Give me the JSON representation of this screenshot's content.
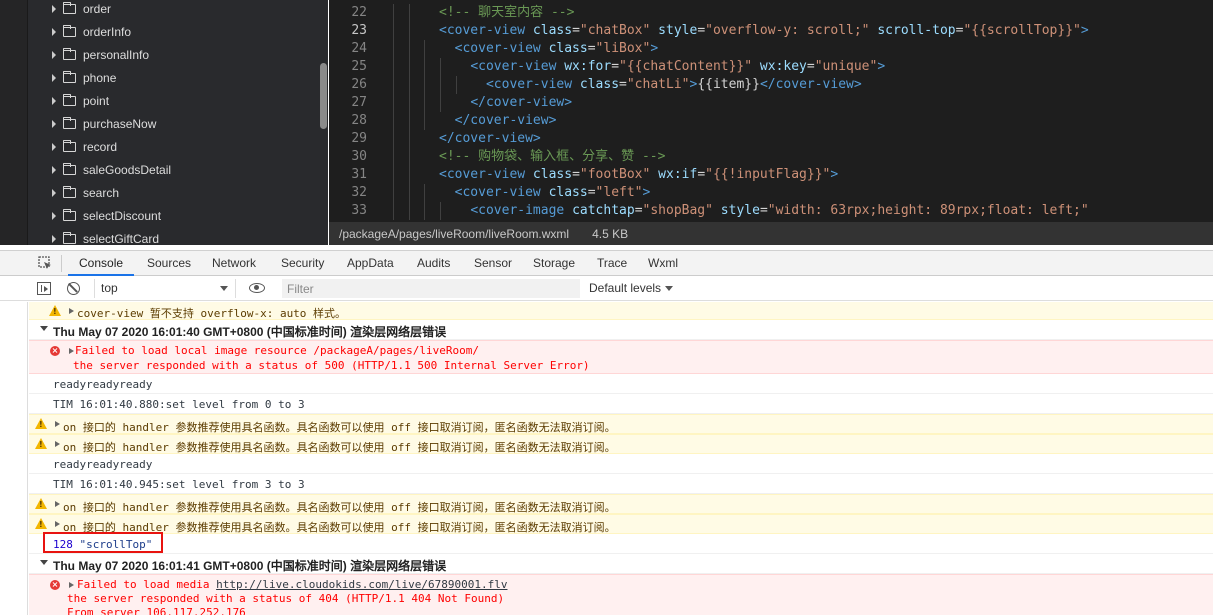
{
  "file_tree": {
    "items": [
      "order",
      "orderInfo",
      "personalInfo",
      "phone",
      "point",
      "purchaseNow",
      "record",
      "saleGoodsDetail",
      "search",
      "selectDiscount",
      "selectGiftCard"
    ]
  },
  "editor": {
    "lines": [
      {
        "num": "22",
        "indent": 4,
        "parts": [
          {
            "c": "cm",
            "t": "<!-- 聊天室内容 -->"
          }
        ]
      },
      {
        "num": "23",
        "indent": 4,
        "current": true,
        "parts": [
          {
            "c": "tg",
            "t": "<cover-view "
          },
          {
            "c": "at",
            "t": "class"
          },
          {
            "c": "tx",
            "t": "="
          },
          {
            "c": "st",
            "t": "\"chatBox\""
          },
          {
            "c": "tx",
            "t": " "
          },
          {
            "c": "at",
            "t": "style"
          },
          {
            "c": "tx",
            "t": "="
          },
          {
            "c": "st",
            "t": "\"overflow-y: scroll;\""
          },
          {
            "c": "tx",
            "t": " "
          },
          {
            "c": "at",
            "t": "scroll-top"
          },
          {
            "c": "tx",
            "t": "="
          },
          {
            "c": "st",
            "t": "\"{{scrollTop}}\""
          },
          {
            "c": "tg",
            "t": ">"
          }
        ]
      },
      {
        "num": "24",
        "indent": 6,
        "parts": [
          {
            "c": "tg",
            "t": "<cover-view "
          },
          {
            "c": "at",
            "t": "class"
          },
          {
            "c": "tx",
            "t": "="
          },
          {
            "c": "st",
            "t": "\"liBox\""
          },
          {
            "c": "tg",
            "t": ">"
          }
        ]
      },
      {
        "num": "25",
        "indent": 8,
        "parts": [
          {
            "c": "tg",
            "t": "<cover-view "
          },
          {
            "c": "at",
            "t": "wx:for"
          },
          {
            "c": "tx",
            "t": "="
          },
          {
            "c": "st",
            "t": "\"{{chatContent}}\""
          },
          {
            "c": "tx",
            "t": " "
          },
          {
            "c": "at",
            "t": "wx:key"
          },
          {
            "c": "tx",
            "t": "="
          },
          {
            "c": "st",
            "t": "\"unique\""
          },
          {
            "c": "tg",
            "t": ">"
          }
        ]
      },
      {
        "num": "26",
        "indent": 10,
        "parts": [
          {
            "c": "tg",
            "t": "<cover-view "
          },
          {
            "c": "at",
            "t": "class"
          },
          {
            "c": "tx",
            "t": "="
          },
          {
            "c": "st",
            "t": "\"chatLi\""
          },
          {
            "c": "tg",
            "t": ">"
          },
          {
            "c": "tx",
            "t": "{{item}}"
          },
          {
            "c": "tg",
            "t": "</cover-view>"
          }
        ]
      },
      {
        "num": "27",
        "indent": 8,
        "parts": [
          {
            "c": "tg",
            "t": "</cover-view>"
          }
        ]
      },
      {
        "num": "28",
        "indent": 6,
        "parts": [
          {
            "c": "tg",
            "t": "</cover-view>"
          }
        ]
      },
      {
        "num": "29",
        "indent": 4,
        "parts": [
          {
            "c": "tg",
            "t": "</cover-view>"
          }
        ]
      },
      {
        "num": "30",
        "indent": 4,
        "parts": [
          {
            "c": "cm",
            "t": "<!-- 购物袋、输入框、分享、赞 -->"
          }
        ]
      },
      {
        "num": "31",
        "indent": 4,
        "parts": [
          {
            "c": "tg",
            "t": "<cover-view "
          },
          {
            "c": "at",
            "t": "class"
          },
          {
            "c": "tx",
            "t": "="
          },
          {
            "c": "st",
            "t": "\"footBox\""
          },
          {
            "c": "tx",
            "t": " "
          },
          {
            "c": "at",
            "t": "wx:if"
          },
          {
            "c": "tx",
            "t": "="
          },
          {
            "c": "st",
            "t": "\"{{!inputFlag}}\""
          },
          {
            "c": "tg",
            "t": ">"
          }
        ]
      },
      {
        "num": "32",
        "indent": 6,
        "parts": [
          {
            "c": "tg",
            "t": "<cover-view "
          },
          {
            "c": "at",
            "t": "class"
          },
          {
            "c": "tx",
            "t": "="
          },
          {
            "c": "st",
            "t": "\"left\""
          },
          {
            "c": "tg",
            "t": ">"
          }
        ]
      },
      {
        "num": "33",
        "indent": 8,
        "parts": [
          {
            "c": "tg",
            "t": "<cover-image "
          },
          {
            "c": "at",
            "t": "catchtap"
          },
          {
            "c": "tx",
            "t": "="
          },
          {
            "c": "st",
            "t": "\"shopBag\""
          },
          {
            "c": "tx",
            "t": " "
          },
          {
            "c": "at",
            "t": "style"
          },
          {
            "c": "tx",
            "t": "="
          },
          {
            "c": "st",
            "t": "\"width: 63rpx;height: 89rpx;float: left;\""
          }
        ]
      }
    ],
    "status_path": "/packageA/pages/liveRoom/liveRoom.wxml",
    "status_size": "4.5 KB"
  },
  "devtools": {
    "tabs": [
      "Console",
      "Sources",
      "Network",
      "Security",
      "AppData",
      "Audits",
      "Sensor",
      "Storage",
      "Trace",
      "Wxml"
    ],
    "active_tab": "Console"
  },
  "console_toolbar": {
    "context": "top",
    "filter_placeholder": "Filter",
    "levels": "Default levels"
  },
  "console": {
    "warn_1": "cover-view 暂不支持 overflow-x: auto 样式。",
    "group_1": "Thu May 07 2020 16:01:40 GMT+0800 (中国标准时间) 渲染层网络层错误",
    "err_1_line1": "Failed to load local image resource /packageA/pages/liveRoom/",
    "err_1_line2": "the server responded with a status of 500 (HTTP/1.1 500 Internal Server Error)",
    "log_1": "readyreadyready",
    "log_2": "TIM 16:01:40.880:set level from 0 to 3",
    "warn_2": "on 接口的 handler 参数推荐使用具名函数。具名函数可以使用 off 接口取消订阅，匿名函数无法取消订阅。",
    "warn_3": "on 接口的 handler 参数推荐使用具名函数。具名函数可以使用 off 接口取消订阅，匿名函数无法取消订阅。",
    "log_3": "readyreadyready",
    "log_4": "TIM 16:01:40.945:set level from 3 to 3",
    "warn_4": "on 接口的 handler 参数推荐使用具名函数。具名函数可以使用 off 接口取消订阅，匿名函数无法取消订阅。",
    "warn_5": "on 接口的 handler 参数推荐使用具名函数。具名函数可以使用 off 接口取消订阅，匿名函数无法取消订阅。",
    "scroll_num": "128",
    "scroll_str": "\"scrollTop\"",
    "group_2": "Thu May 07 2020 16:01:41 GMT+0800 (中国标准时间) 渲染层网络层错误",
    "err_2_prefix": "Failed to load media ",
    "err_2_url": "http://live.cloudokids.com/live/67890001.flv",
    "err_2_line2": "the server responded with a status of 404 (HTTP/1.1 404 Not Found)",
    "err_2_line3": "From server 106.117.252.176"
  },
  "colors": {
    "editor_bg": "#1e1e1e",
    "tree_bg": "#292a2d",
    "warn_bg": "#fffbe5",
    "err_bg": "#fff0f0",
    "highlight": "#e8130f",
    "tab_active": "#1a73e8"
  }
}
